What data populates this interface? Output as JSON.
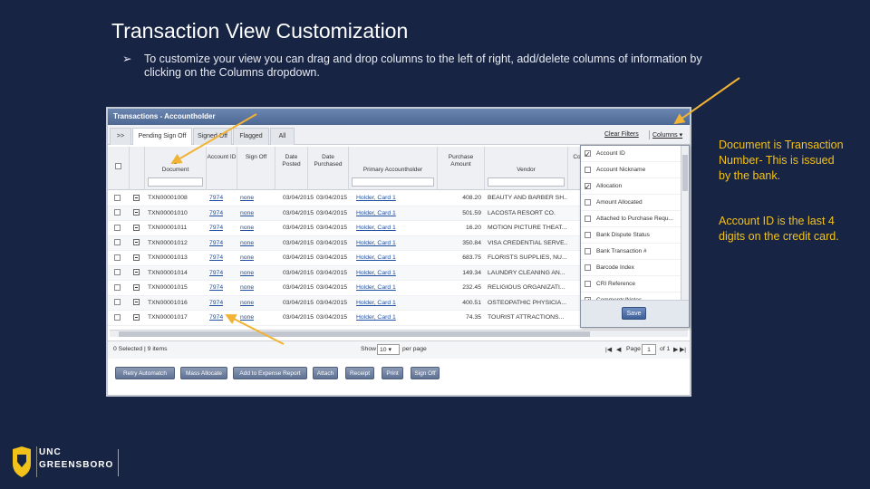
{
  "slide": {
    "title": "Transaction View Customization",
    "bullet_glyph": "➢",
    "bullet_text": "To customize your view you can drag and drop columns to the left of right, add/delete columns of information by clicking on the Columns dropdown.",
    "note_document": "Document is Transaction Number- This is issued by the bank.",
    "note_account": "Account ID is the last 4 digits on the credit card.",
    "accent_color": "#f2c21b"
  },
  "window": {
    "title": "Transactions - Accountholder",
    "tabs": [
      ">>",
      "Pending Sign Off",
      "Signed Off",
      "Flagged",
      "All"
    ],
    "clear_filters": "Clear Filters",
    "columns_label": "Columns",
    "headers": {
      "document": "Document",
      "account_id": "Account ID",
      "sign_off": "Sign Off",
      "date_posted": "Date Posted",
      "date_purchased": "Date Purchased",
      "primary_accountholder": "Primary Accountholder",
      "purchase_amount": "Purchase Amount",
      "vendor": "Vendor",
      "co": "Co"
    },
    "rows": [
      {
        "doc": "TXN00001008",
        "acct": "7974",
        "sign": "none",
        "posted": "03/04/2015",
        "purchased": "03/04/2015",
        "holder": "Holder, Card 1",
        "amount": "408.20",
        "vendor": "BEAUTY AND BARBER SH..."
      },
      {
        "doc": "TXN00001010",
        "acct": "7974",
        "sign": "none",
        "posted": "03/04/2015",
        "purchased": "03/04/2015",
        "holder": "Holder, Card 1",
        "amount": "501.59",
        "vendor": "LACOSTA RESORT CO."
      },
      {
        "doc": "TXN00001011",
        "acct": "7974",
        "sign": "none",
        "posted": "03/04/2015",
        "purchased": "03/04/2015",
        "holder": "Holder, Card 1",
        "amount": "16.20",
        "vendor": "MOTION PICTURE THEAT..."
      },
      {
        "doc": "TXN00001012",
        "acct": "7974",
        "sign": "none",
        "posted": "03/04/2015",
        "purchased": "03/04/2015",
        "holder": "Holder, Card 1",
        "amount": "350.84",
        "vendor": "VISA CREDENTIAL SERVE..."
      },
      {
        "doc": "TXN00001013",
        "acct": "7974",
        "sign": "none",
        "posted": "03/04/2015",
        "purchased": "03/04/2015",
        "holder": "Holder, Card 1",
        "amount": "683.75",
        "vendor": "FLORISTS SUPPLIES, NU..."
      },
      {
        "doc": "TXN00001014",
        "acct": "7974",
        "sign": "none",
        "posted": "03/04/2015",
        "purchased": "03/04/2015",
        "holder": "Holder, Card 1",
        "amount": "149.34",
        "vendor": "LAUNDRY CLEANING AN..."
      },
      {
        "doc": "TXN00001015",
        "acct": "7974",
        "sign": "none",
        "posted": "03/04/2015",
        "purchased": "03/04/2015",
        "holder": "Holder, Card 1",
        "amount": "232.45",
        "vendor": "RELIGIOUS ORGANIZATI..."
      },
      {
        "doc": "TXN00001016",
        "acct": "7974",
        "sign": "none",
        "posted": "03/04/2015",
        "purchased": "03/04/2015",
        "holder": "Holder, Card 1",
        "amount": "400.51",
        "vendor": "OSTEOPATHIC PHYSICIA..."
      },
      {
        "doc": "TXN00001017",
        "acct": "7974",
        "sign": "none",
        "posted": "03/04/2015",
        "purchased": "03/04/2015",
        "holder": "Holder, Card 1",
        "amount": "74.35",
        "vendor": "TOURIST ATTRACTIONS..."
      }
    ],
    "column_options": [
      {
        "label": "Account ID",
        "checked": true
      },
      {
        "label": "Account Nickname",
        "checked": false
      },
      {
        "label": "Allocation",
        "checked": true
      },
      {
        "label": "Amount Allocated",
        "checked": false
      },
      {
        "label": "Attached to Purchase Requ...",
        "checked": false
      },
      {
        "label": "Bank Dispute Status",
        "checked": false
      },
      {
        "label": "Bank Transaction #",
        "checked": false
      },
      {
        "label": "Barcode Index",
        "checked": false
      },
      {
        "label": "CRI Reference",
        "checked": false
      },
      {
        "label": "Comments/Notes",
        "checked": true
      }
    ],
    "save_label": "Save",
    "pager": {
      "selected": "0 Selected | 9 items",
      "show": "Show",
      "per_page_value": "10",
      "per_page": "per page",
      "page": "Page",
      "page_value": "1",
      "of": "of 1"
    },
    "actions": [
      "Retry Automatch",
      "Mass Allocate",
      "Add to Expense Report",
      "Attach",
      "Receipt",
      "Print",
      "Sign Off"
    ]
  },
  "logo": {
    "line1": "UNC",
    "line2": "GREENSBORO"
  }
}
